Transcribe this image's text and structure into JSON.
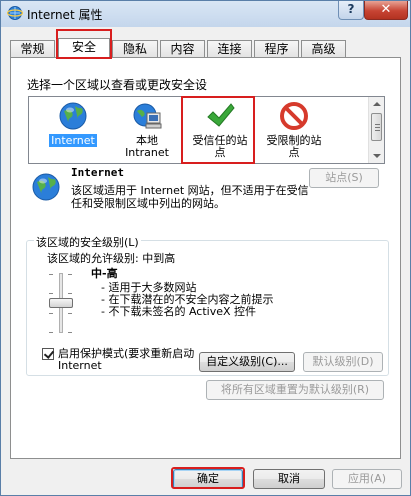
{
  "window": {
    "title": "Internet 属性",
    "help_label": "?",
    "close_label": "✕"
  },
  "tabs": [
    {
      "label": "常规",
      "active": false
    },
    {
      "label": "安全",
      "active": true
    },
    {
      "label": "隐私",
      "active": false
    },
    {
      "label": "内容",
      "active": false
    },
    {
      "label": "连接",
      "active": false
    },
    {
      "label": "程序",
      "active": false
    },
    {
      "label": "高级",
      "active": false
    }
  ],
  "security": {
    "zone_prompt": "选择一个区域以查看或更改安全设",
    "zones": [
      {
        "label": "Internet",
        "icon": "globe-icon",
        "selected": true
      },
      {
        "label": "本地\nIntranet",
        "icon": "intranet-icon",
        "selected": false
      },
      {
        "label": "受信任的站\n点",
        "icon": "check-icon",
        "selected": false
      },
      {
        "label": "受限制的站\n点",
        "icon": "no-entry-icon",
        "selected": false
      }
    ],
    "zone_info": {
      "name": "Internet",
      "description": "该区域适用于 Internet 网站，但不适用于在受信任和受限制区域中列出的网站。"
    },
    "sites_button": "站点(S)",
    "level_group_title": "该区域的安全级别(L)",
    "allowed_level": "该区域的允许级别: 中到高",
    "level_name": "中-高",
    "level_bullets": [
      "- 适用于大多数网站",
      "- 在下载潜在的不安全内容之前提示",
      "- 不下载未签名的 ActiveX 控件"
    ],
    "protected_mode_label": "启用保护模式(要求重新启动 Internet",
    "custom_level_button": "自定义级别(C)...",
    "default_level_button": "默认级别(D)",
    "reset_all_button": "将所有区域重置为默认级别(R)"
  },
  "footer": {
    "ok": "确定",
    "cancel": "取消",
    "apply": "应用(A)"
  },
  "colors": {
    "highlight_red": "#d81e1e",
    "selection_blue": "#3399ff",
    "check_green": "#3aa83a",
    "no_entry_red": "#d63a2c"
  }
}
